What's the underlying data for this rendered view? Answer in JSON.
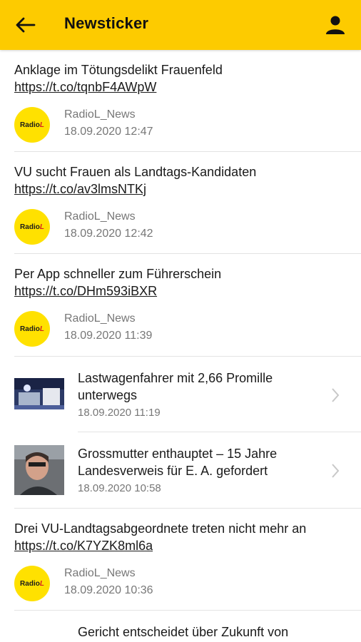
{
  "header": {
    "title": "Newsticker",
    "back_icon": "arrow-left-icon",
    "user_icon": "person-icon",
    "color": "#fdcb00"
  },
  "tweets": [
    {
      "text": "Anklage im Tötungsdelikt Frauenfeld",
      "link": "https://t.co/tqnbF4AWpW",
      "author": "RadioL_News",
      "date": "18.09.2020 12:47"
    },
    {
      "text": "VU sucht Frauen als Landtags-Kandidaten",
      "link": "https://t.co/av3lmsNTKj",
      "author": "RadioL_News",
      "date": "18.09.2020 12:42"
    },
    {
      "text": "Per App schneller zum Führerschein",
      "link": "https://t.co/DHm593iBXR",
      "author": "RadioL_News",
      "date": "18.09.2020 11:39"
    }
  ],
  "articles": [
    {
      "title": "Lastwagenfahrer mit 2,66 Promille unterwegs",
      "date": "18.09.2020 11:19"
    },
    {
      "title": "Grossmutter enthauptet – 15 Jahre Landesverweis für E. A. gefordert",
      "date": "18.09.2020 10:58"
    }
  ],
  "tweet4": {
    "text": "Drei VU-Landtagsabgeordnete treten nicht mehr an",
    "link": "https://t.co/K7YZK8ml6a",
    "author": "RadioL_News",
    "date": "18.09.2020 10:36"
  },
  "partial_article": {
    "title": "Gericht entscheidet über Zukunft von"
  },
  "logo": {
    "word": "Radio",
    "mark": "L"
  }
}
